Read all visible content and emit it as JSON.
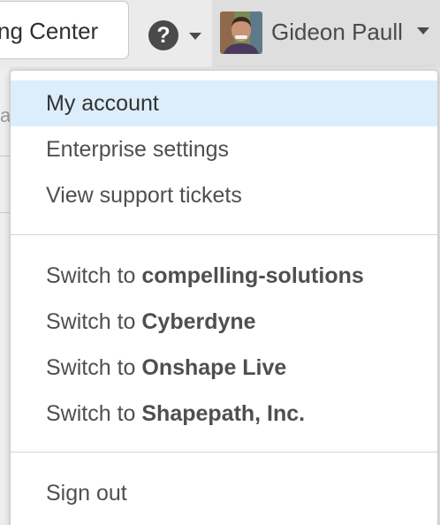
{
  "topbar": {
    "learning_center_label": "ng Center",
    "help_icon_glyph": "?",
    "background_fragment": "a"
  },
  "user": {
    "name": "Gideon Paull"
  },
  "menu": {
    "account_items": [
      {
        "label": "My account",
        "active": true
      },
      {
        "label": "Enterprise settings"
      },
      {
        "label": "View support tickets"
      }
    ],
    "switch_prefix": "Switch to",
    "workspaces": [
      {
        "name": "compelling-solutions"
      },
      {
        "name": "Cyberdyne"
      },
      {
        "name": "Onshape Live"
      },
      {
        "name": "Shapepath, Inc."
      }
    ],
    "sign_out_label": "Sign out"
  },
  "colors": {
    "active_item_bg": "#dceefb",
    "menu_text": "#4f4f4f",
    "topbar_bg": "#ebebeb"
  }
}
